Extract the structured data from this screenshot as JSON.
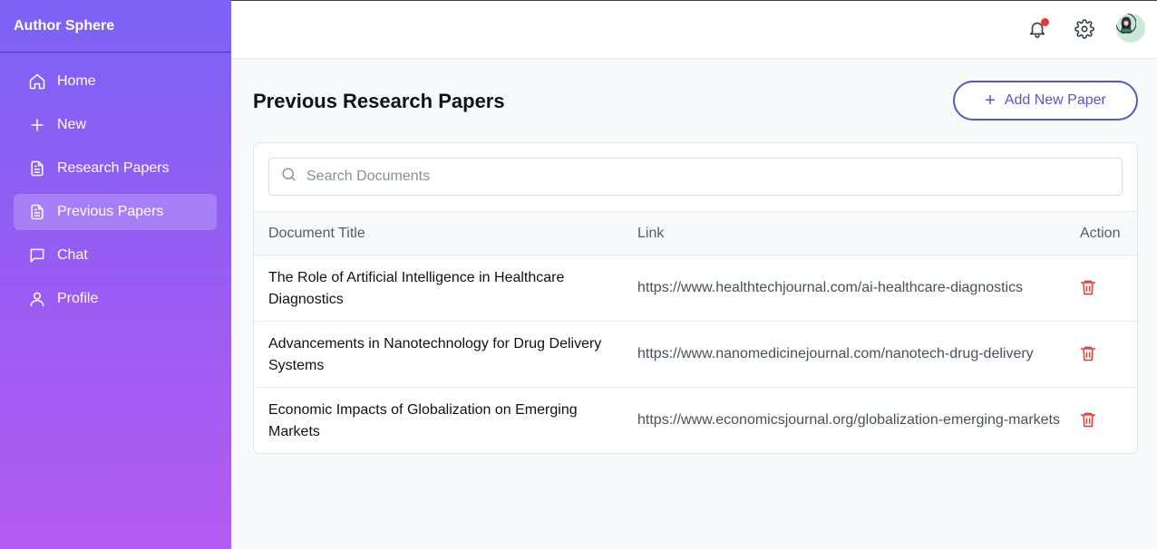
{
  "app": {
    "title": "Author Sphere"
  },
  "sidebar": {
    "items": [
      {
        "label": "Home",
        "icon": "home-icon"
      },
      {
        "label": "New",
        "icon": "plus-icon"
      },
      {
        "label": "Research Papers",
        "icon": "document-icon"
      },
      {
        "label": "Previous Papers",
        "icon": "document-icon",
        "active": true
      },
      {
        "label": "Chat",
        "icon": "chat-icon"
      },
      {
        "label": "Profile",
        "icon": "user-icon"
      }
    ]
  },
  "header": {
    "icons": [
      "bell-icon",
      "gear-icon",
      "avatar"
    ],
    "notification_dot_color": "#e53935"
  },
  "main": {
    "title": "Previous Research Papers",
    "add_button_label": "Add New Paper",
    "search_placeholder": "Search Documents",
    "columns": [
      "Document Title",
      "Link",
      "Action"
    ],
    "rows": [
      {
        "title": "The Role of Artificial Intelligence in Healthcare Diagnostics",
        "link": "https://www.healthtechjournal.com/ai-healthcare-diagnostics"
      },
      {
        "title": "Advancements in Nanotechnology for Drug Delivery Systems",
        "link": "https://www.nanomedicinejournal.com/nanotech-drug-delivery"
      },
      {
        "title": "Economic Impacts of Globalization on Emerging Markets",
        "link": "https://www.economicsjournal.org/globalization-emerging-markets"
      }
    ]
  },
  "colors": {
    "sidebar_gradient_start": "#7b63f5",
    "sidebar_gradient_end": "#b35cf3",
    "accent": "#5a55c2",
    "delete": "#e53935"
  }
}
